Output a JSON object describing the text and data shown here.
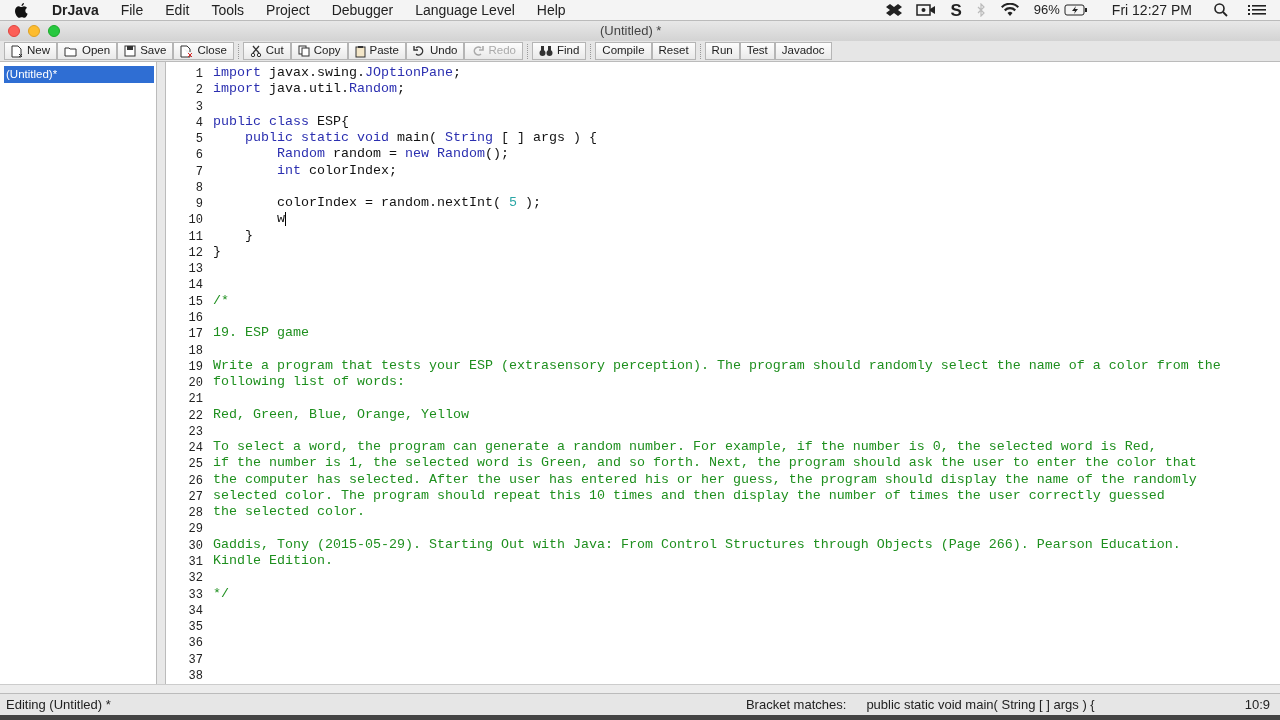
{
  "menu_bar": {
    "app": "DrJava",
    "items": [
      "File",
      "Edit",
      "Tools",
      "Project",
      "Debugger",
      "Language Level",
      "Help"
    ],
    "s_icon": "S",
    "battery": "96%",
    "clock": "Fri 12:27 PM"
  },
  "window": {
    "title": "(Untitled) *"
  },
  "toolbar": {
    "groups": [
      [
        {
          "label": "New",
          "disabled": false
        },
        {
          "label": "Open",
          "disabled": false
        },
        {
          "label": "Save",
          "disabled": false
        },
        {
          "label": "Close",
          "disabled": false
        }
      ],
      [
        {
          "label": "Cut",
          "disabled": false
        },
        {
          "label": "Copy",
          "disabled": false
        },
        {
          "label": "Paste",
          "disabled": false
        },
        {
          "label": "Undo",
          "disabled": false
        },
        {
          "label": "Redo",
          "disabled": true
        }
      ],
      [
        {
          "label": "Find",
          "disabled": false
        }
      ],
      [
        {
          "label": "Compile",
          "disabled": false
        },
        {
          "label": "Reset",
          "disabled": false
        }
      ],
      [
        {
          "label": "Run",
          "disabled": false
        },
        {
          "label": "Test",
          "disabled": false
        },
        {
          "label": "Javadoc",
          "disabled": false
        }
      ]
    ]
  },
  "documents": [
    {
      "name": "(Untitled)*",
      "selected": true
    }
  ],
  "editor": {
    "lines": [
      {
        "number": "1",
        "caret": false,
        "tokens": [
          {
            "text": "import",
            "kind": "keyword"
          },
          {
            "text": " javax.swing.",
            "kind": "plain"
          },
          {
            "text": "JOptionPane",
            "kind": "keyword"
          },
          {
            "text": ";",
            "kind": "plain"
          }
        ]
      },
      {
        "number": "2",
        "caret": false,
        "tokens": [
          {
            "text": "import",
            "kind": "keyword"
          },
          {
            "text": " java.util.",
            "kind": "plain"
          },
          {
            "text": "Random",
            "kind": "keyword"
          },
          {
            "text": ";",
            "kind": "plain"
          }
        ]
      },
      {
        "number": "3",
        "caret": false
      },
      {
        "number": "4",
        "caret": false,
        "tokens": [
          {
            "text": "public class",
            "kind": "keyword"
          },
          {
            "text": " ESP{",
            "kind": "plain"
          }
        ]
      },
      {
        "number": "5",
        "caret": false,
        "tokens": [
          {
            "text": "    public static void",
            "kind": "keyword"
          },
          {
            "text": " main( ",
            "kind": "plain"
          },
          {
            "text": "String",
            "kind": "keyword"
          },
          {
            "text": " [ ] args ) {",
            "kind": "plain"
          }
        ]
      },
      {
        "number": "6",
        "caret": false,
        "tokens": [
          {
            "text": "        Random",
            "kind": "keyword"
          },
          {
            "text": " random = ",
            "kind": "plain"
          },
          {
            "text": "new Random",
            "kind": "keyword"
          },
          {
            "text": "();",
            "kind": "plain"
          }
        ]
      },
      {
        "number": "7",
        "caret": false,
        "tokens": [
          {
            "text": "        int",
            "kind": "keyword"
          },
          {
            "text": " colorIndex;",
            "kind": "plain"
          }
        ]
      },
      {
        "number": "8",
        "caret": false
      },
      {
        "number": "9",
        "caret": false,
        "tokens": [
          {
            "text": "        colorIndex = random.nextInt( ",
            "kind": "plain"
          },
          {
            "text": "5",
            "kind": "number"
          },
          {
            "text": " );",
            "kind": "plain"
          }
        ]
      },
      {
        "number": "10",
        "caret": true,
        "tokens": [
          {
            "text": "        w",
            "kind": "plain"
          }
        ]
      },
      {
        "number": "11",
        "caret": false,
        "tokens": [
          {
            "text": "    }",
            "kind": "plain"
          }
        ]
      },
      {
        "number": "12",
        "caret": false,
        "tokens": [
          {
            "text": "}",
            "kind": "plain"
          }
        ]
      },
      {
        "number": "13",
        "caret": false
      },
      {
        "number": "14",
        "caret": false
      },
      {
        "number": "15",
        "caret": false,
        "tokens": [
          {
            "text": "/*",
            "kind": "comment"
          }
        ]
      },
      {
        "number": "16",
        "caret": false
      },
      {
        "number": "17",
        "caret": false,
        "tokens": [
          {
            "text": "19. ESP game",
            "kind": "comment"
          }
        ]
      },
      {
        "number": "18",
        "caret": false
      },
      {
        "number": "19",
        "caret": false,
        "tokens": [
          {
            "text": "Write a program that tests your ESP (extrasensory perception). The program should randomly select the name of a color from the",
            "kind": "comment"
          }
        ]
      },
      {
        "number": "20",
        "caret": false,
        "tokens": [
          {
            "text": "following list of words:",
            "kind": "comment"
          }
        ]
      },
      {
        "number": "21",
        "caret": false
      },
      {
        "number": "22",
        "caret": false,
        "tokens": [
          {
            "text": "Red, Green, Blue, Orange, Yellow",
            "kind": "comment"
          }
        ]
      },
      {
        "number": "23",
        "caret": false
      },
      {
        "number": "24",
        "caret": false,
        "tokens": [
          {
            "text": "To select a word, the program can generate a random number. For example, if the number is 0, the selected word is Red,",
            "kind": "comment"
          }
        ]
      },
      {
        "number": "25",
        "caret": false,
        "tokens": [
          {
            "text": "if the number is 1, the selected word is Green, and so forth. Next, the program should ask the user to enter the color that",
            "kind": "comment"
          }
        ]
      },
      {
        "number": "26",
        "caret": false,
        "tokens": [
          {
            "text": "the computer has selected. After the user has entered his or her guess, the program should display the name of the randomly",
            "kind": "comment"
          }
        ]
      },
      {
        "number": "27",
        "caret": false,
        "tokens": [
          {
            "text": "selected color. The program should repeat this 10 times and then display the number of times the user correctly guessed",
            "kind": "comment"
          }
        ]
      },
      {
        "number": "28",
        "caret": false,
        "tokens": [
          {
            "text": "the selected color.",
            "kind": "comment"
          }
        ]
      },
      {
        "number": "29",
        "caret": false
      },
      {
        "number": "30",
        "caret": false,
        "tokens": [
          {
            "text": "Gaddis, Tony (2015-05-29). Starting Out with Java: From Control Structures through Objects (Page 266). Pearson Education.",
            "kind": "comment"
          }
        ]
      },
      {
        "number": "31",
        "caret": false,
        "tokens": [
          {
            "text": "Kindle Edition.",
            "kind": "comment"
          }
        ]
      },
      {
        "number": "32",
        "caret": false
      },
      {
        "number": "33",
        "caret": false,
        "tokens": [
          {
            "text": "*/",
            "kind": "comment"
          }
        ]
      },
      {
        "number": "34",
        "caret": false
      },
      {
        "number": "35",
        "caret": false
      },
      {
        "number": "36",
        "caret": false
      },
      {
        "number": "37",
        "caret": false
      },
      {
        "number": "38",
        "caret": false
      }
    ]
  },
  "status_bar": {
    "message": "Editing (Untitled) *",
    "bracket_label": "Bracket matches:",
    "bracket_match": "public static void main( String [ ] args ) {",
    "position": "10:9"
  }
}
